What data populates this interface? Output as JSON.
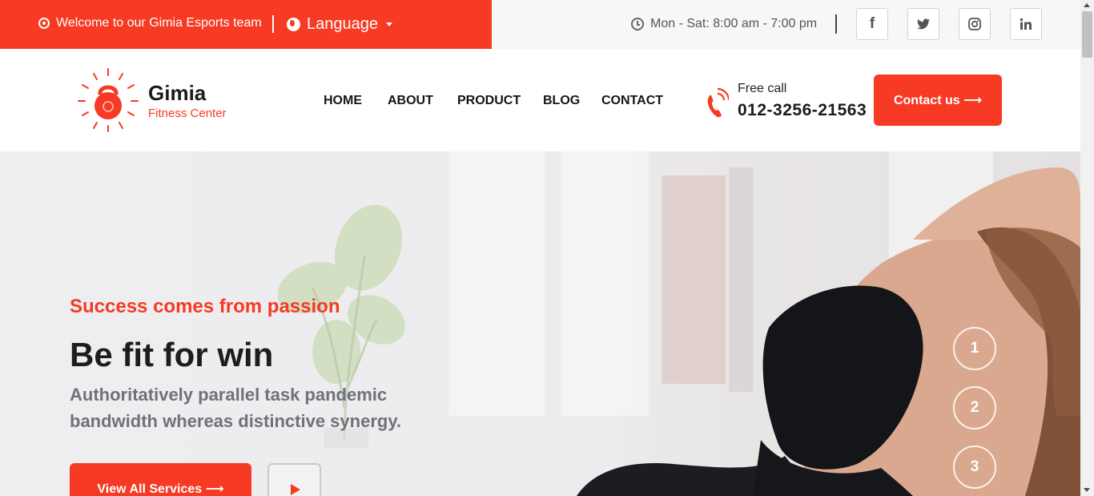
{
  "topbar": {
    "welcome_text": "Welcome to our Gimia Esports team",
    "language_label": "Language",
    "hours_text": "Mon - Sat: 8:00 am - 7:00 pm",
    "social": [
      {
        "icon": "facebook-icon",
        "glyph": "f"
      },
      {
        "icon": "twitter-icon",
        "glyph": "t"
      },
      {
        "icon": "instagram-icon",
        "glyph": "◎"
      },
      {
        "icon": "linkedin-icon",
        "glyph": "in"
      }
    ]
  },
  "header": {
    "brand_name": "Gimia",
    "brand_tagline": "Fitness Center",
    "nav": [
      "HOME",
      "ABOUT",
      "PRODUCT",
      "BLOG",
      "CONTACT"
    ],
    "freecall_label": "Free call",
    "freecall_number": "012-3256-21563",
    "contact_button": "Contact us ⟶"
  },
  "hero": {
    "kicker": "Success comes from passion",
    "title": "Be fit for win",
    "description": "Authoritatively parallel task pandemic bandwidth whereas distinctive synergy.",
    "services_button": "View All Services ⟶",
    "slides": [
      "1",
      "2",
      "3"
    ]
  },
  "colors": {
    "accent": "#f63a23",
    "dark_text": "#1b1b1b",
    "muted_text": "#6f7279"
  }
}
